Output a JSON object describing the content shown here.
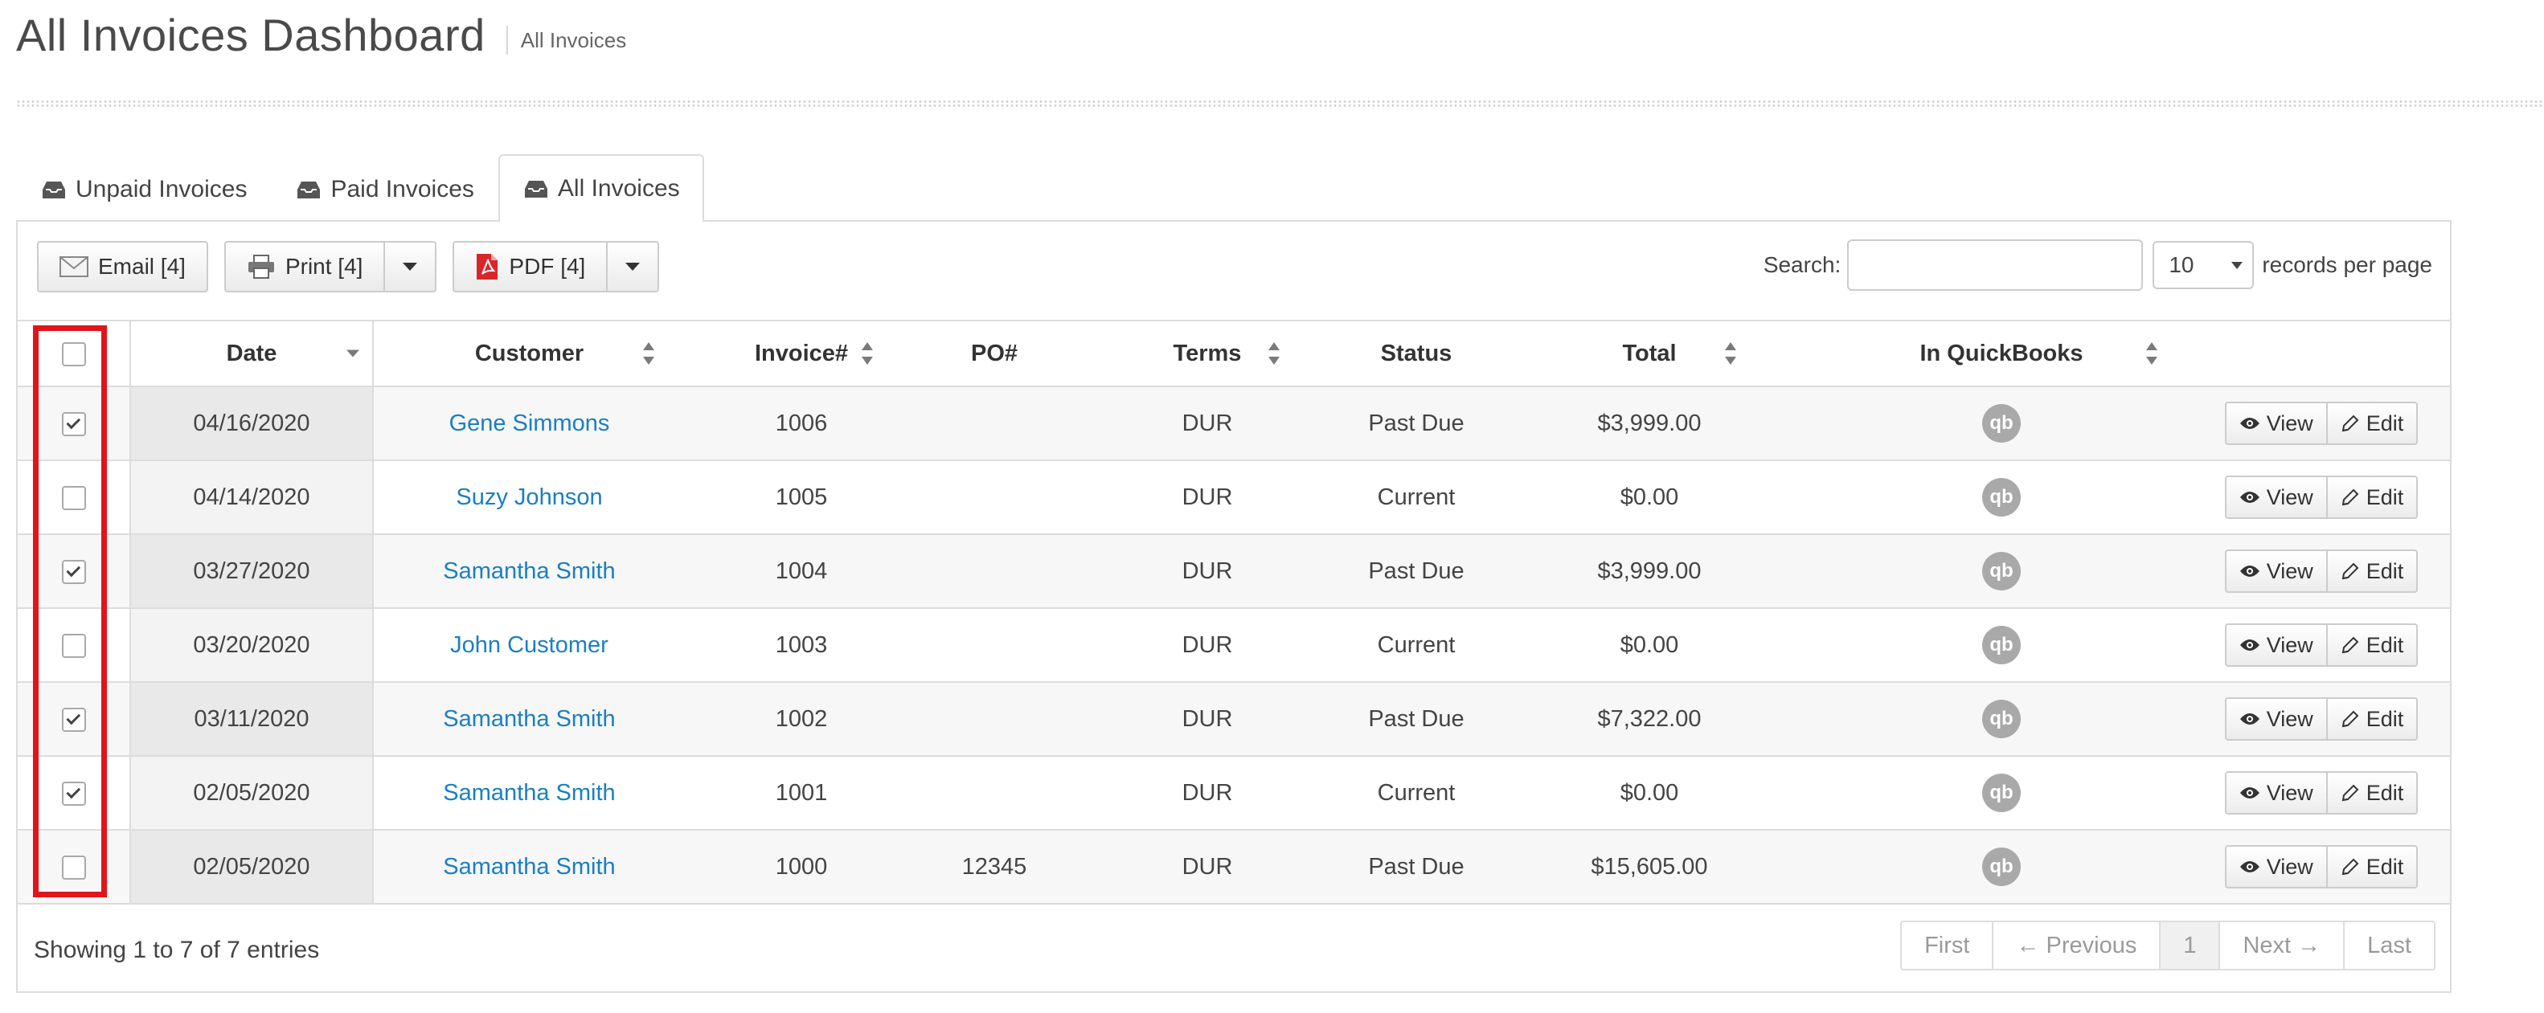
{
  "header": {
    "title": "All Invoices Dashboard",
    "breadcrumb": "All Invoices"
  },
  "tabs": [
    {
      "label": "Unpaid Invoices",
      "icon": "inbox-icon",
      "active": false
    },
    {
      "label": "Paid Invoices",
      "icon": "inbox-icon",
      "active": false
    },
    {
      "label": "All Invoices",
      "icon": "inbox-icon",
      "active": true
    }
  ],
  "toolbar": {
    "email_label": "Email [4]",
    "print_label": "Print [4]",
    "pdf_label": "PDF [4]",
    "search_label": "Search:",
    "search_value": "",
    "records_value": "10",
    "records_label": "records per page"
  },
  "table": {
    "columns": [
      "Date",
      "Customer",
      "Invoice#",
      "PO#",
      "Terms",
      "Status",
      "Total",
      "In QuickBooks"
    ],
    "rows": [
      {
        "checked": true,
        "date": "04/16/2020",
        "customer": "Gene Simmons",
        "invoice": "1006",
        "po": "",
        "terms": "DUR",
        "status": "Past Due",
        "total": "$3,999.00"
      },
      {
        "checked": false,
        "date": "04/14/2020",
        "customer": "Suzy Johnson",
        "invoice": "1005",
        "po": "",
        "terms": "DUR",
        "status": "Current",
        "total": "$0.00"
      },
      {
        "checked": true,
        "date": "03/27/2020",
        "customer": "Samantha Smith",
        "invoice": "1004",
        "po": "",
        "terms": "DUR",
        "status": "Past Due",
        "total": "$3,999.00"
      },
      {
        "checked": false,
        "date": "03/20/2020",
        "customer": "John Customer",
        "invoice": "1003",
        "po": "",
        "terms": "DUR",
        "status": "Current",
        "total": "$0.00"
      },
      {
        "checked": true,
        "date": "03/11/2020",
        "customer": "Samantha Smith",
        "invoice": "1002",
        "po": "",
        "terms": "DUR",
        "status": "Past Due",
        "total": "$7,322.00"
      },
      {
        "checked": true,
        "date": "02/05/2020",
        "customer": "Samantha Smith",
        "invoice": "1001",
        "po": "",
        "terms": "DUR",
        "status": "Current",
        "total": "$0.00"
      },
      {
        "checked": false,
        "date": "02/05/2020",
        "customer": "Samantha Smith",
        "invoice": "1000",
        "po": "12345",
        "terms": "DUR",
        "status": "Past Due",
        "total": "$15,605.00"
      }
    ],
    "view_label": "View",
    "edit_label": "Edit",
    "qb_icon_text": "qb"
  },
  "footer": {
    "info": "Showing 1 to 7 of 7 entries",
    "pager": {
      "first": "First",
      "previous": "← Previous",
      "current": "1",
      "next": "Next →",
      "last": "Last"
    }
  },
  "colors": {
    "link": "#1a7fc1",
    "highlight": "#e0151b",
    "quickbooks_icon": "#a9a9a9"
  }
}
